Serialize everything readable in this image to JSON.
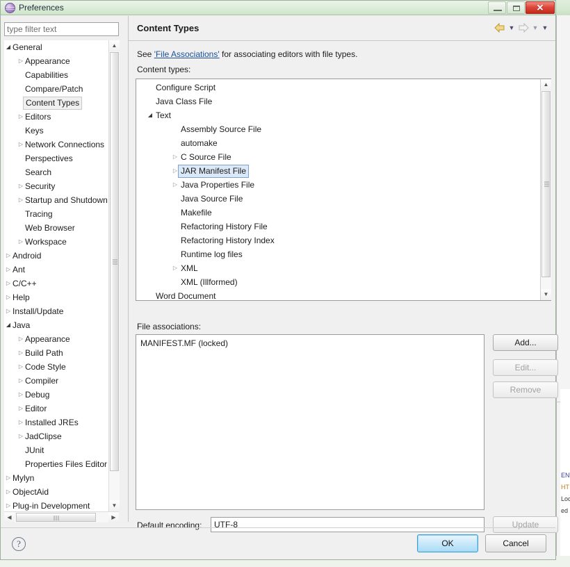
{
  "window": {
    "title": "Preferences",
    "icon": "eclipse-sphere-icon",
    "minimize_label": "Minimize",
    "maximize_label": "Maximize",
    "close_label": "✕"
  },
  "filter": {
    "placeholder": "type filter text",
    "value": ""
  },
  "sidebar": {
    "items": [
      {
        "label": "General",
        "indent": 0,
        "arrow": "expanded",
        "selected": false
      },
      {
        "label": "Appearance",
        "indent": 1,
        "arrow": "collapsed",
        "selected": false
      },
      {
        "label": "Capabilities",
        "indent": 1,
        "arrow": "none",
        "selected": false
      },
      {
        "label": "Compare/Patch",
        "indent": 1,
        "arrow": "none",
        "selected": false
      },
      {
        "label": "Content Types",
        "indent": 1,
        "arrow": "none",
        "selected": true
      },
      {
        "label": "Editors",
        "indent": 1,
        "arrow": "collapsed",
        "selected": false
      },
      {
        "label": "Keys",
        "indent": 1,
        "arrow": "none",
        "selected": false
      },
      {
        "label": "Network Connections",
        "indent": 1,
        "arrow": "collapsed",
        "selected": false
      },
      {
        "label": "Perspectives",
        "indent": 1,
        "arrow": "none",
        "selected": false
      },
      {
        "label": "Search",
        "indent": 1,
        "arrow": "none",
        "selected": false
      },
      {
        "label": "Security",
        "indent": 1,
        "arrow": "collapsed",
        "selected": false
      },
      {
        "label": "Startup and Shutdown",
        "indent": 1,
        "arrow": "collapsed",
        "selected": false
      },
      {
        "label": "Tracing",
        "indent": 1,
        "arrow": "none",
        "selected": false
      },
      {
        "label": "Web Browser",
        "indent": 1,
        "arrow": "none",
        "selected": false
      },
      {
        "label": "Workspace",
        "indent": 1,
        "arrow": "collapsed",
        "selected": false
      },
      {
        "label": "Android",
        "indent": 0,
        "arrow": "collapsed",
        "selected": false
      },
      {
        "label": "Ant",
        "indent": 0,
        "arrow": "collapsed",
        "selected": false
      },
      {
        "label": "C/C++",
        "indent": 0,
        "arrow": "collapsed",
        "selected": false
      },
      {
        "label": "Help",
        "indent": 0,
        "arrow": "collapsed",
        "selected": false
      },
      {
        "label": "Install/Update",
        "indent": 0,
        "arrow": "collapsed",
        "selected": false
      },
      {
        "label": "Java",
        "indent": 0,
        "arrow": "expanded",
        "selected": false
      },
      {
        "label": "Appearance",
        "indent": 1,
        "arrow": "collapsed",
        "selected": false
      },
      {
        "label": "Build Path",
        "indent": 1,
        "arrow": "collapsed",
        "selected": false
      },
      {
        "label": "Code Style",
        "indent": 1,
        "arrow": "collapsed",
        "selected": false
      },
      {
        "label": "Compiler",
        "indent": 1,
        "arrow": "collapsed",
        "selected": false
      },
      {
        "label": "Debug",
        "indent": 1,
        "arrow": "collapsed",
        "selected": false
      },
      {
        "label": "Editor",
        "indent": 1,
        "arrow": "collapsed",
        "selected": false
      },
      {
        "label": "Installed JREs",
        "indent": 1,
        "arrow": "collapsed",
        "selected": false
      },
      {
        "label": "JadClipse",
        "indent": 1,
        "arrow": "collapsed",
        "selected": false
      },
      {
        "label": "JUnit",
        "indent": 1,
        "arrow": "none",
        "selected": false
      },
      {
        "label": "Properties Files Editor",
        "indent": 1,
        "arrow": "none",
        "selected": false
      },
      {
        "label": "Mylyn",
        "indent": 0,
        "arrow": "collapsed",
        "selected": false
      },
      {
        "label": "ObjectAid",
        "indent": 0,
        "arrow": "collapsed",
        "selected": false
      },
      {
        "label": "Plug-in Development",
        "indent": 0,
        "arrow": "collapsed",
        "selected": false
      }
    ]
  },
  "page": {
    "title": "Content Types",
    "description_prefix": "See ",
    "description_link": "'File Associations'",
    "description_suffix": " for associating editors with file types.",
    "content_types_label": "Content types:",
    "nav_back_icon": "back-arrow-icon",
    "nav_forward_icon": "forward-arrow-icon",
    "nav_menu_icon": "chevron-down-icon"
  },
  "content_types": {
    "items": [
      {
        "label": "Configure Script",
        "indent": 0,
        "arrow": "none",
        "selected": false
      },
      {
        "label": "Java Class File",
        "indent": 0,
        "arrow": "none",
        "selected": false
      },
      {
        "label": "Text",
        "indent": 0,
        "arrow": "expanded",
        "selected": false
      },
      {
        "label": "Assembly Source File",
        "indent": 1,
        "arrow": "none",
        "selected": false
      },
      {
        "label": "automake",
        "indent": 1,
        "arrow": "none",
        "selected": false
      },
      {
        "label": "C Source File",
        "indent": 1,
        "arrow": "collapsed",
        "selected": false
      },
      {
        "label": "JAR Manifest File",
        "indent": 1,
        "arrow": "collapsed",
        "selected": true
      },
      {
        "label": "Java Properties File",
        "indent": 1,
        "arrow": "collapsed",
        "selected": false
      },
      {
        "label": "Java Source File",
        "indent": 1,
        "arrow": "none",
        "selected": false
      },
      {
        "label": "Makefile",
        "indent": 1,
        "arrow": "none",
        "selected": false
      },
      {
        "label": "Refactoring History File",
        "indent": 1,
        "arrow": "none",
        "selected": false
      },
      {
        "label": "Refactoring History Index",
        "indent": 1,
        "arrow": "none",
        "selected": false
      },
      {
        "label": "Runtime log files",
        "indent": 1,
        "arrow": "none",
        "selected": false
      },
      {
        "label": "XML",
        "indent": 1,
        "arrow": "collapsed",
        "selected": false
      },
      {
        "label": "XML (Illformed)",
        "indent": 1,
        "arrow": "none",
        "selected": false
      },
      {
        "label": "Word Document",
        "indent": 0,
        "arrow": "none",
        "selected": false
      }
    ]
  },
  "file_associations": {
    "label": "File associations:",
    "entries": [
      "MANIFEST.MF (locked)"
    ],
    "add_label": "Add...",
    "edit_label": "Edit...",
    "remove_label": "Remove",
    "add_enabled": true,
    "edit_enabled": false,
    "remove_enabled": false
  },
  "encoding": {
    "label": "Default encoding:",
    "value": "UTF-8",
    "update_label": "Update",
    "update_enabled": false
  },
  "footer": {
    "help_label": "?",
    "ok_label": "OK",
    "cancel_label": "Cancel"
  },
  "background": {
    "fragments": [
      "ENT",
      "HT",
      "Loc",
      "ed"
    ]
  },
  "colors": {
    "title_bar": "#dfeedd",
    "selection_blue": "#dbe8f7",
    "selection_border": "#7da2cc",
    "link": "#1a4f9c",
    "ok_accent": "#3c9fd6",
    "close_red": "#c4281c",
    "nav_arrow_yellow": "#e8c54a"
  }
}
